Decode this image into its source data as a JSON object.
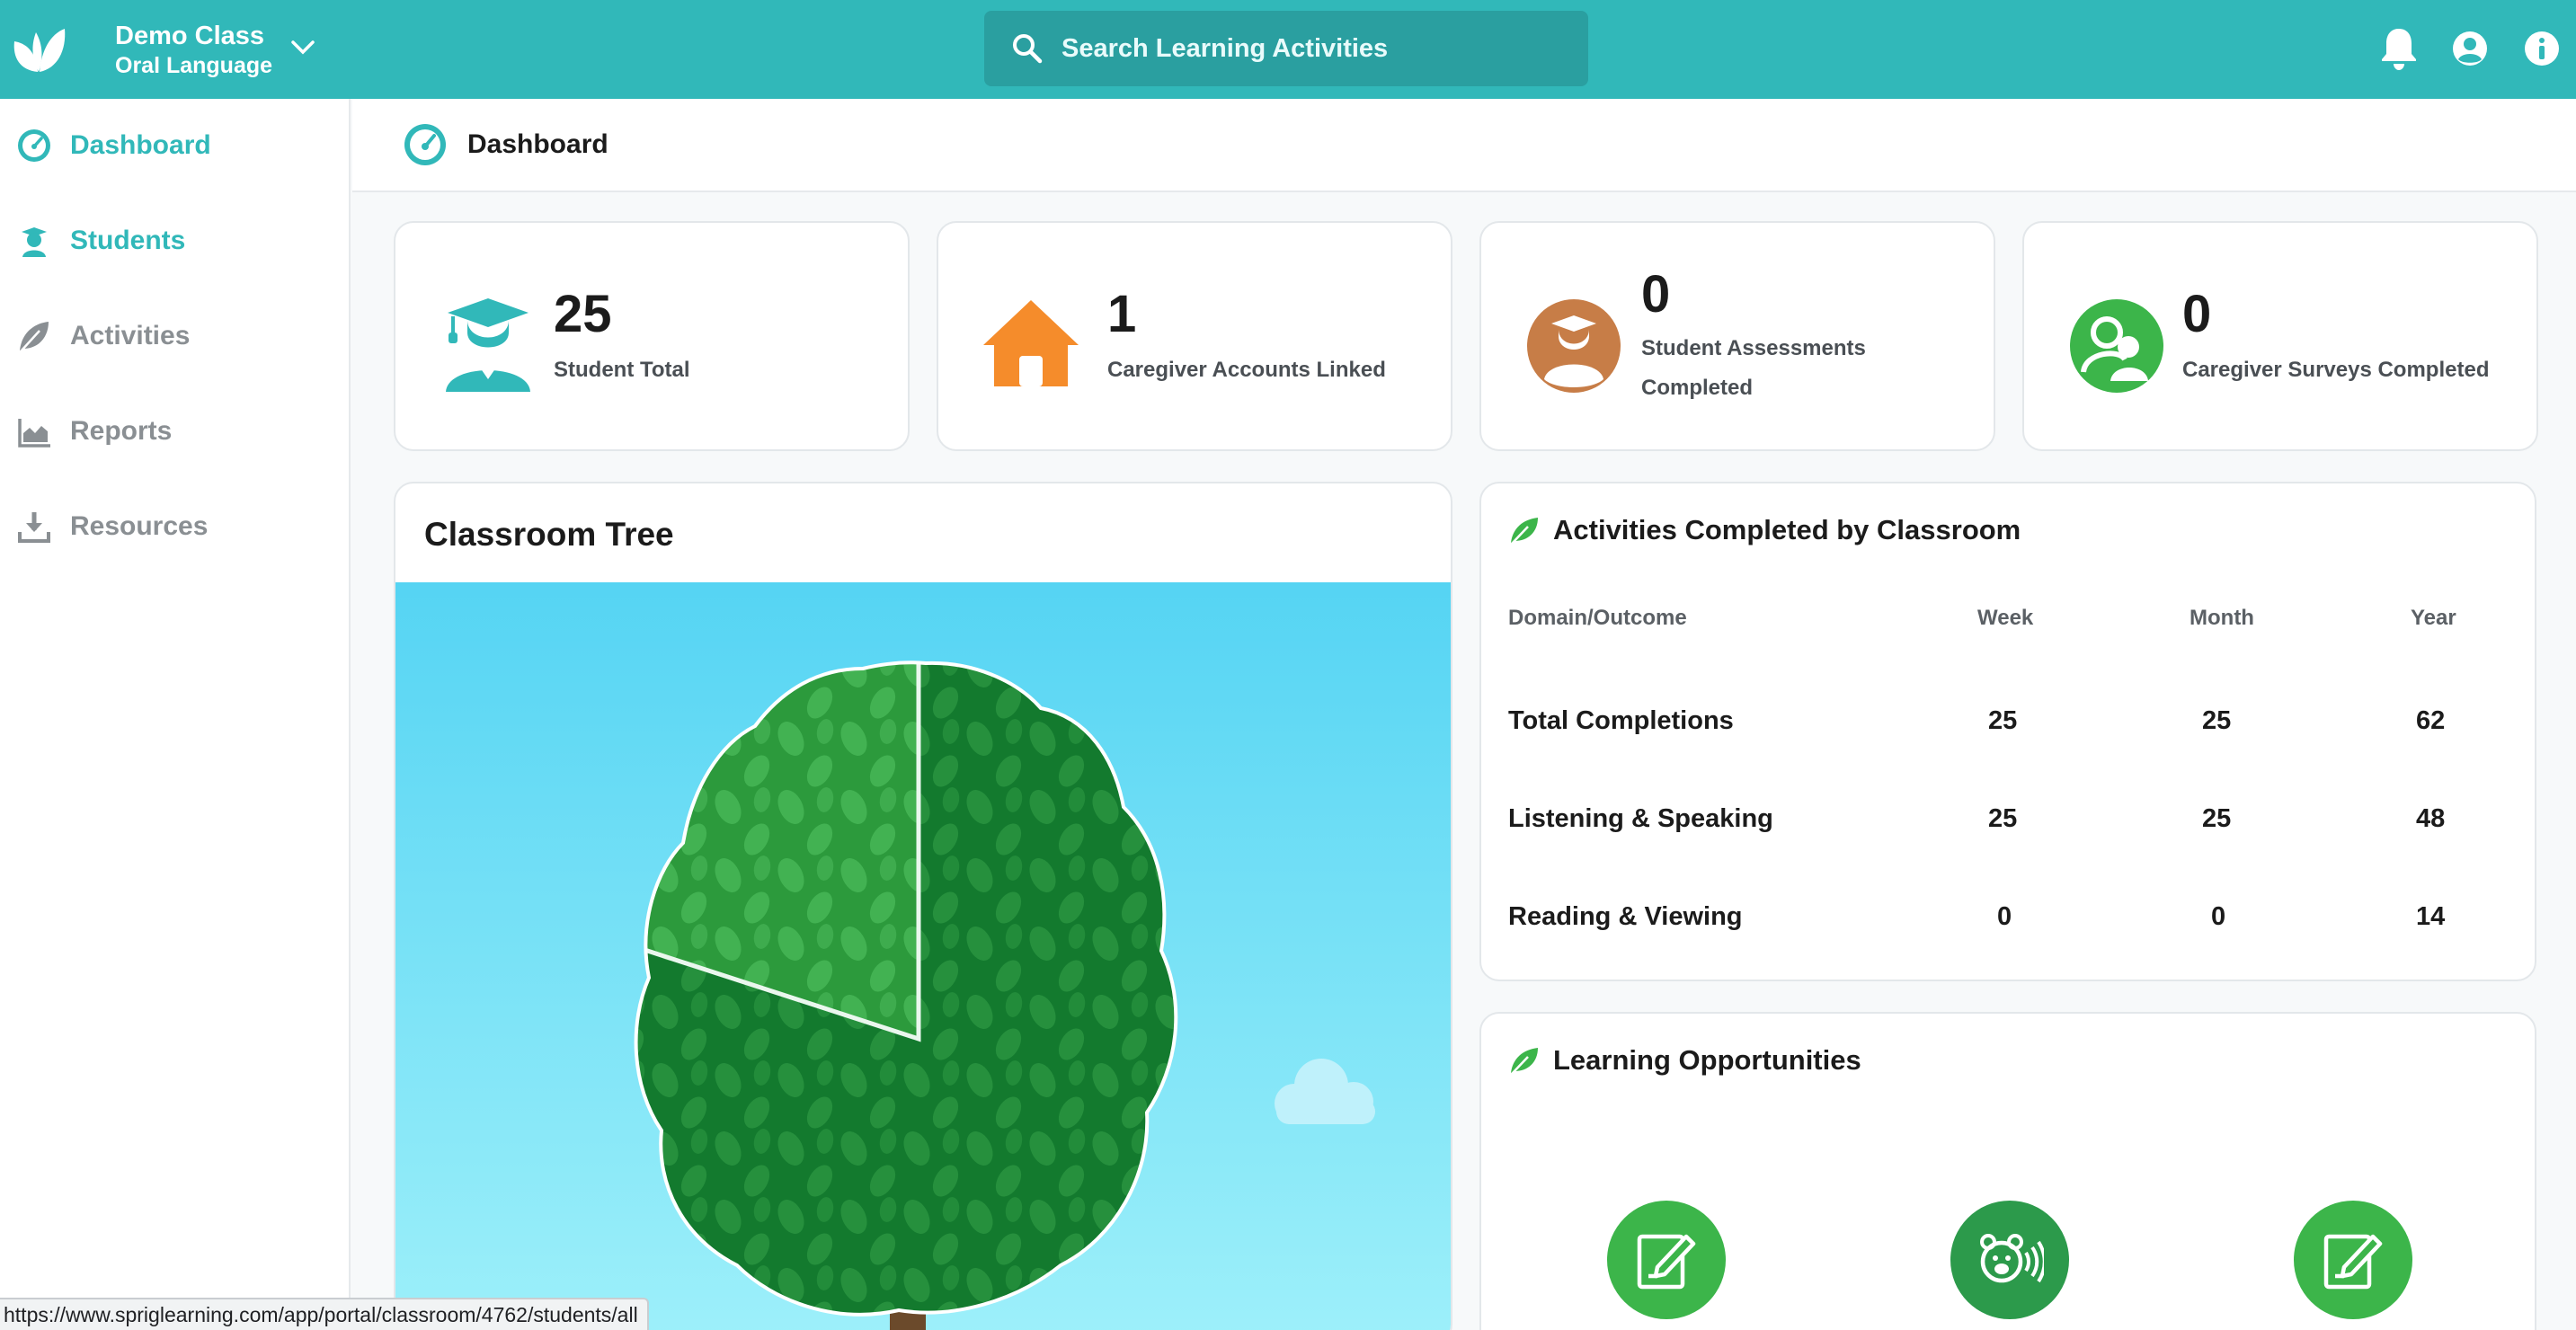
{
  "header": {
    "class_name": "Demo Class",
    "class_subject": "Oral Language",
    "search_placeholder": "Search Learning Activities"
  },
  "sidebar": {
    "items": [
      {
        "label": "Dashboard",
        "icon": "gauge-icon",
        "state": "active"
      },
      {
        "label": "Students",
        "icon": "student-icon",
        "state": "highlight"
      },
      {
        "label": "Activities",
        "icon": "leaf-icon",
        "state": "muted"
      },
      {
        "label": "Reports",
        "icon": "area-chart-icon",
        "state": "muted"
      },
      {
        "label": "Resources",
        "icon": "download-icon",
        "state": "muted"
      }
    ]
  },
  "breadcrumb": {
    "title": "Dashboard"
  },
  "stats": [
    {
      "value": "25",
      "label": "Student Total",
      "icon": "graduate-icon",
      "color": "#31b8b9"
    },
    {
      "value": "1",
      "label": "Caregiver Accounts Linked",
      "icon": "house-icon",
      "color": "#f58c2b"
    },
    {
      "value": "0",
      "label_line1": "Student Assessments",
      "label_line2": "Completed",
      "icon": "assessment-icon",
      "color": "#c77d47"
    },
    {
      "value": "0",
      "label": "Caregiver Surveys Completed",
      "icon": "users-icon",
      "color": "#3cb54a"
    }
  ],
  "tree": {
    "title": "Classroom Tree",
    "progress_fraction": 0.2
  },
  "activities": {
    "title": "Activities Completed by Classroom",
    "columns": [
      "Domain/Outcome",
      "Week",
      "Month",
      "Year"
    ],
    "rows": [
      {
        "label": "Total Completions",
        "week": "25",
        "month": "25",
        "year": "62"
      },
      {
        "label": "Listening & Speaking",
        "week": "25",
        "month": "25",
        "year": "48"
      },
      {
        "label": "Reading & Viewing",
        "week": "0",
        "month": "0",
        "year": "14"
      }
    ]
  },
  "learning": {
    "title": "Learning Opportunities",
    "buttons": [
      {
        "icon": "edit-note-icon",
        "color": "#3cb54a"
      },
      {
        "icon": "bear-speaking-icon",
        "color": "#2c9a4b"
      },
      {
        "icon": "edit-note-icon",
        "color": "#3cb54a"
      }
    ]
  },
  "status_bar": {
    "url": "https://www.spriglearning.com/app/portal/classroom/4762/students/all"
  },
  "colors": {
    "brand": "#31b8b9",
    "search_bg": "#2a9fa0",
    "leaf_light": "#2c9a3c",
    "leaf_dark": "#137a2e",
    "sky": "#55d4f3"
  }
}
